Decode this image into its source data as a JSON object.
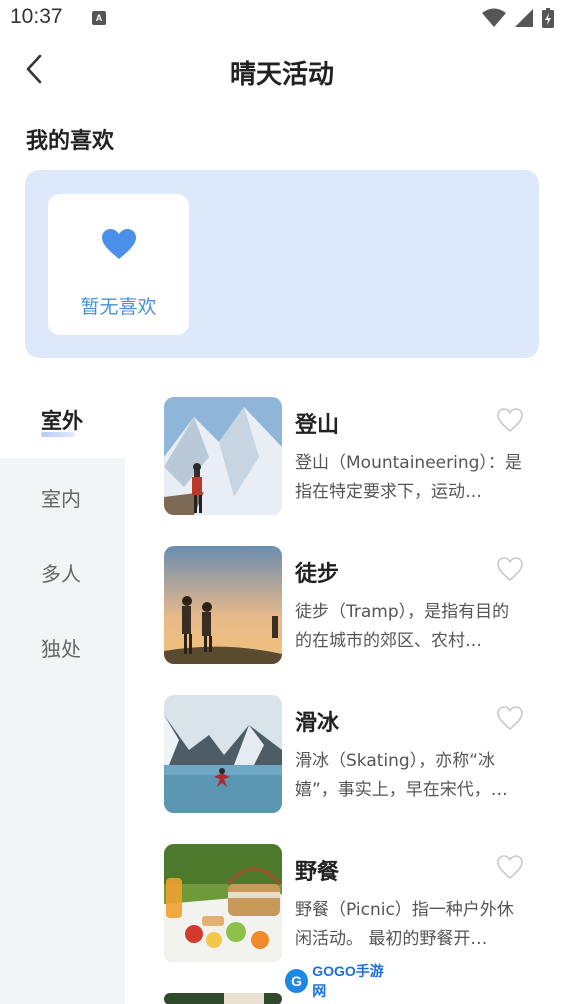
{
  "status_bar": {
    "time": "10:37",
    "notification_letter": "A"
  },
  "header": {
    "title": "晴天活动"
  },
  "favorites": {
    "title": "我的喜欢",
    "empty_text": "暂无喜欢"
  },
  "sidebar": {
    "items": [
      {
        "label": "室外",
        "active": true
      },
      {
        "label": "室内",
        "active": false
      },
      {
        "label": "多人",
        "active": false
      },
      {
        "label": "独处",
        "active": false
      }
    ]
  },
  "activities": [
    {
      "title": "登山",
      "desc": "登山（Mountaineering）：是指在特定要求下，运动…",
      "image": "mountain-climbing"
    },
    {
      "title": "徒步",
      "desc": "徒步（Tramp），是指有目的的在城市的郊区、农村…",
      "image": "hiking-sunset"
    },
    {
      "title": "滑冰",
      "desc": "滑冰（Skating），亦称“冰嬉”，事实上，早在宋代，…",
      "image": "ice-skating"
    },
    {
      "title": "野餐",
      "desc": "野餐（Picnic）指一种户外休闲活动。 最初的野餐开…",
      "image": "picnic-basket"
    }
  ],
  "watermark": {
    "text": "GOGO手游网",
    "logo": "G"
  },
  "colors": {
    "accent": "#4a8fd6",
    "panel": "#dde9fb",
    "sidebar": "#f3f4f6"
  }
}
